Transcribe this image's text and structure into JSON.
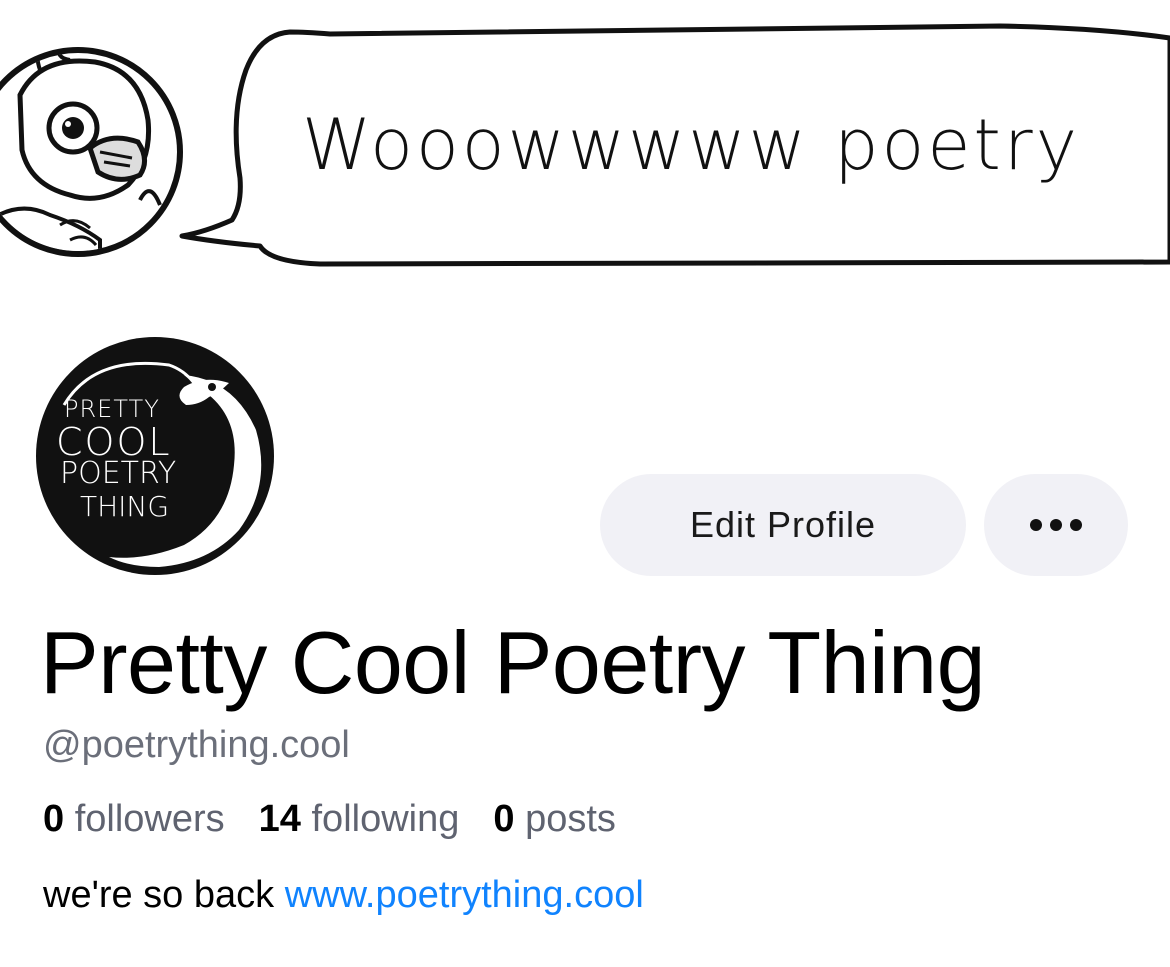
{
  "banner": {
    "speech_text": "Wooowwwww poetry",
    "character_icon": "bird-character-illustration",
    "bubble_icon": "speech-bubble"
  },
  "avatar": {
    "icon": "avatar-logo",
    "logo_lines": [
      "PRETTY",
      "COOL",
      "POETRY",
      "THING"
    ]
  },
  "actions": {
    "edit_profile_label": "Edit Profile",
    "more_icon": "ellipsis-icon"
  },
  "profile": {
    "display_name": "Pretty Cool Poetry Thing",
    "handle": "@poetrything.cool",
    "stats": [
      {
        "count": "0",
        "label": "followers"
      },
      {
        "count": "14",
        "label": "following"
      },
      {
        "count": "0",
        "label": "posts"
      }
    ],
    "bio_text": "we're so back ",
    "bio_link": "www.poetrything.cool"
  },
  "colors": {
    "link": "#1083fe",
    "secondary_text": "#6b6f7a",
    "button_bg": "#f1f1f6"
  }
}
